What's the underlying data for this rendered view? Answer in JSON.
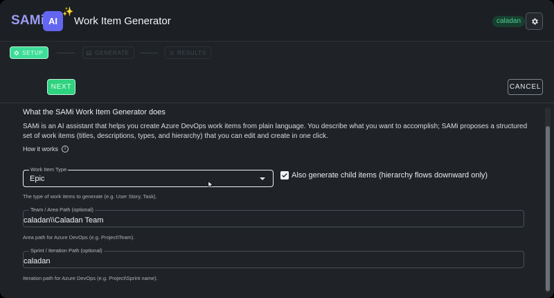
{
  "header": {
    "brand": "SAMi",
    "ai_badge": "AI",
    "sparkle": "✨",
    "title": "Work Item Generator",
    "user_badge": "caladan",
    "settings_icon": "gear-icon"
  },
  "stepper": {
    "steps": [
      {
        "label": "SETUP",
        "icon": "gear-icon",
        "state": "active"
      },
      {
        "label": "GENERATE",
        "icon": "image-icon",
        "state": "inactive"
      },
      {
        "label": "RESULTS",
        "icon": "list-icon",
        "state": "inactive"
      }
    ]
  },
  "actions": {
    "next_label": "NEXT",
    "cancel_label": "CANCEL"
  },
  "content": {
    "heading": "What the SAMi Work Item Generator does",
    "description": "SAMi is an AI assistant that helps you create Azure DevOps work items from plain language. You describe what you want to accomplish; SAMi proposes a structured set of work items (titles, descriptions, types, and hierarchy) that you can edit and create in one click.",
    "how_it_works": "How it works",
    "info_glyph": "i",
    "work_item_type": {
      "label": "Work Item Type",
      "value": "Epic",
      "helper": "The type of work items to generate (e.g. User Story, Task)."
    },
    "child_items": {
      "checked": true,
      "label": "Also generate child items (hierarchy flows downward only)"
    },
    "team_area": {
      "label": "Team / Area Path (optional)",
      "value": "caladan\\\\Caladan Team",
      "helper": "Area path for Azure DevOps (e.g. Project\\Team)."
    },
    "sprint": {
      "label": "Sprint / Iteration Path (optional)",
      "value": "caladan",
      "helper": "Iteration path for Azure DevOps (e.g. Project\\Sprint name)."
    }
  },
  "colors": {
    "accent_green": "#2fd37f",
    "brand_purple": "#6366f1",
    "background": "#1f2327"
  }
}
